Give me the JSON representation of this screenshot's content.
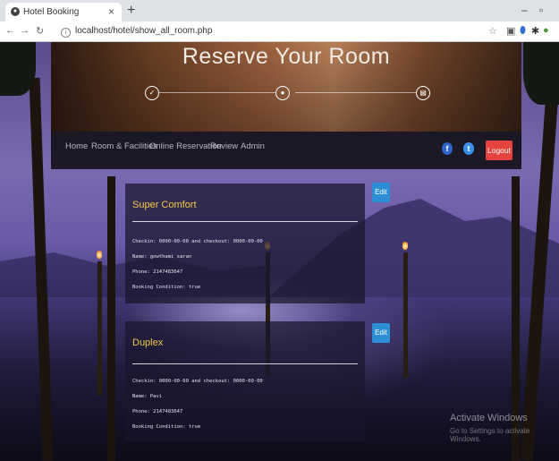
{
  "browser": {
    "tab_title": "Hotel Booking",
    "tab_close": "×",
    "new_tab": "+",
    "url": "localhost/hotel/show_all_room.php",
    "minimize": "–",
    "restore": "▫"
  },
  "header": {
    "title": "Reserve Your Room"
  },
  "nav": {
    "items": [
      "Home",
      "Room & Facilities",
      "Online Reservation",
      "Review",
      "Admin"
    ],
    "logout_label": "Logout",
    "facebook": "f",
    "twitter": "t"
  },
  "bookings": [
    {
      "room": "Super Comfort",
      "dates": "Checkin: 0000-00-00 and checkout: 0000-00-00",
      "name": "Name: gowthami saran",
      "phone": "Phone: 2147483647",
      "condition": "Booking Condition: true",
      "edit_label": "Edit"
    },
    {
      "room": "Duplex",
      "dates": "Checkin: 0000-00-00 and checkout: 0000-00-00",
      "name": "Name: Pavi",
      "phone": "Phone: 2147483647",
      "condition": "Booking Condition: true",
      "edit_label": "Edit"
    }
  ],
  "watermark": {
    "title": "Activate Windows",
    "subtitle": "Go to Settings to activate Windows."
  },
  "colors": {
    "accent_gold": "#f1c84a",
    "edit_blue": "#2c8fd5",
    "logout_red": "#e4433f"
  }
}
